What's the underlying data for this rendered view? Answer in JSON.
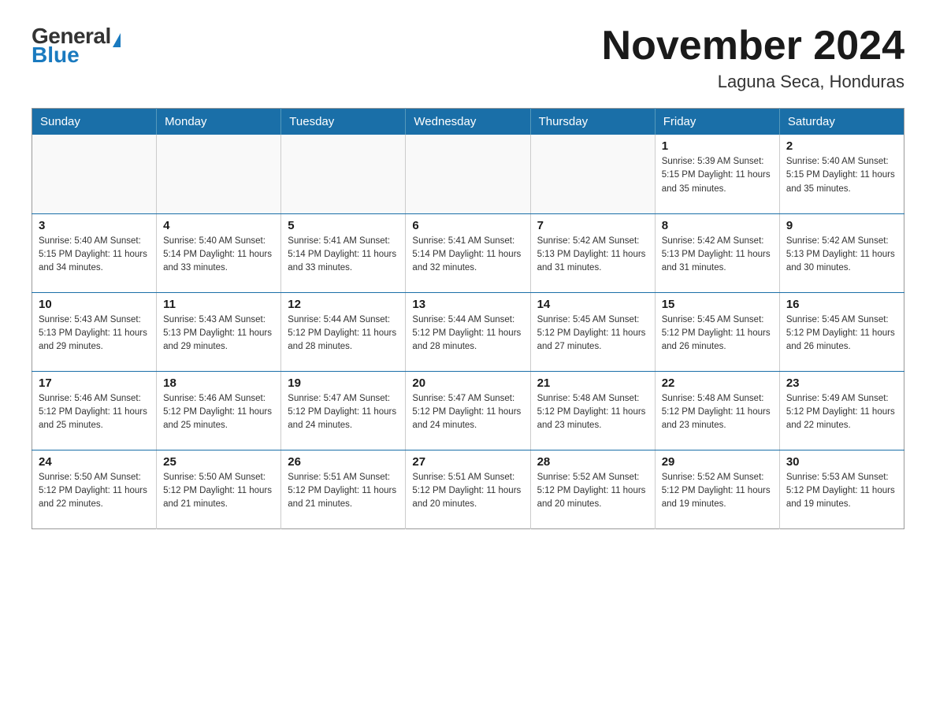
{
  "logo": {
    "general": "General",
    "blue": "Blue"
  },
  "title": "November 2024",
  "location": "Laguna Seca, Honduras",
  "weekdays": [
    "Sunday",
    "Monday",
    "Tuesday",
    "Wednesday",
    "Thursday",
    "Friday",
    "Saturday"
  ],
  "weeks": [
    [
      {
        "day": "",
        "info": ""
      },
      {
        "day": "",
        "info": ""
      },
      {
        "day": "",
        "info": ""
      },
      {
        "day": "",
        "info": ""
      },
      {
        "day": "",
        "info": ""
      },
      {
        "day": "1",
        "info": "Sunrise: 5:39 AM\nSunset: 5:15 PM\nDaylight: 11 hours and 35 minutes."
      },
      {
        "day": "2",
        "info": "Sunrise: 5:40 AM\nSunset: 5:15 PM\nDaylight: 11 hours and 35 minutes."
      }
    ],
    [
      {
        "day": "3",
        "info": "Sunrise: 5:40 AM\nSunset: 5:15 PM\nDaylight: 11 hours and 34 minutes."
      },
      {
        "day": "4",
        "info": "Sunrise: 5:40 AM\nSunset: 5:14 PM\nDaylight: 11 hours and 33 minutes."
      },
      {
        "day": "5",
        "info": "Sunrise: 5:41 AM\nSunset: 5:14 PM\nDaylight: 11 hours and 33 minutes."
      },
      {
        "day": "6",
        "info": "Sunrise: 5:41 AM\nSunset: 5:14 PM\nDaylight: 11 hours and 32 minutes."
      },
      {
        "day": "7",
        "info": "Sunrise: 5:42 AM\nSunset: 5:13 PM\nDaylight: 11 hours and 31 minutes."
      },
      {
        "day": "8",
        "info": "Sunrise: 5:42 AM\nSunset: 5:13 PM\nDaylight: 11 hours and 31 minutes."
      },
      {
        "day": "9",
        "info": "Sunrise: 5:42 AM\nSunset: 5:13 PM\nDaylight: 11 hours and 30 minutes."
      }
    ],
    [
      {
        "day": "10",
        "info": "Sunrise: 5:43 AM\nSunset: 5:13 PM\nDaylight: 11 hours and 29 minutes."
      },
      {
        "day": "11",
        "info": "Sunrise: 5:43 AM\nSunset: 5:13 PM\nDaylight: 11 hours and 29 minutes."
      },
      {
        "day": "12",
        "info": "Sunrise: 5:44 AM\nSunset: 5:12 PM\nDaylight: 11 hours and 28 minutes."
      },
      {
        "day": "13",
        "info": "Sunrise: 5:44 AM\nSunset: 5:12 PM\nDaylight: 11 hours and 28 minutes."
      },
      {
        "day": "14",
        "info": "Sunrise: 5:45 AM\nSunset: 5:12 PM\nDaylight: 11 hours and 27 minutes."
      },
      {
        "day": "15",
        "info": "Sunrise: 5:45 AM\nSunset: 5:12 PM\nDaylight: 11 hours and 26 minutes."
      },
      {
        "day": "16",
        "info": "Sunrise: 5:45 AM\nSunset: 5:12 PM\nDaylight: 11 hours and 26 minutes."
      }
    ],
    [
      {
        "day": "17",
        "info": "Sunrise: 5:46 AM\nSunset: 5:12 PM\nDaylight: 11 hours and 25 minutes."
      },
      {
        "day": "18",
        "info": "Sunrise: 5:46 AM\nSunset: 5:12 PM\nDaylight: 11 hours and 25 minutes."
      },
      {
        "day": "19",
        "info": "Sunrise: 5:47 AM\nSunset: 5:12 PM\nDaylight: 11 hours and 24 minutes."
      },
      {
        "day": "20",
        "info": "Sunrise: 5:47 AM\nSunset: 5:12 PM\nDaylight: 11 hours and 24 minutes."
      },
      {
        "day": "21",
        "info": "Sunrise: 5:48 AM\nSunset: 5:12 PM\nDaylight: 11 hours and 23 minutes."
      },
      {
        "day": "22",
        "info": "Sunrise: 5:48 AM\nSunset: 5:12 PM\nDaylight: 11 hours and 23 minutes."
      },
      {
        "day": "23",
        "info": "Sunrise: 5:49 AM\nSunset: 5:12 PM\nDaylight: 11 hours and 22 minutes."
      }
    ],
    [
      {
        "day": "24",
        "info": "Sunrise: 5:50 AM\nSunset: 5:12 PM\nDaylight: 11 hours and 22 minutes."
      },
      {
        "day": "25",
        "info": "Sunrise: 5:50 AM\nSunset: 5:12 PM\nDaylight: 11 hours and 21 minutes."
      },
      {
        "day": "26",
        "info": "Sunrise: 5:51 AM\nSunset: 5:12 PM\nDaylight: 11 hours and 21 minutes."
      },
      {
        "day": "27",
        "info": "Sunrise: 5:51 AM\nSunset: 5:12 PM\nDaylight: 11 hours and 20 minutes."
      },
      {
        "day": "28",
        "info": "Sunrise: 5:52 AM\nSunset: 5:12 PM\nDaylight: 11 hours and 20 minutes."
      },
      {
        "day": "29",
        "info": "Sunrise: 5:52 AM\nSunset: 5:12 PM\nDaylight: 11 hours and 19 minutes."
      },
      {
        "day": "30",
        "info": "Sunrise: 5:53 AM\nSunset: 5:12 PM\nDaylight: 11 hours and 19 minutes."
      }
    ]
  ]
}
